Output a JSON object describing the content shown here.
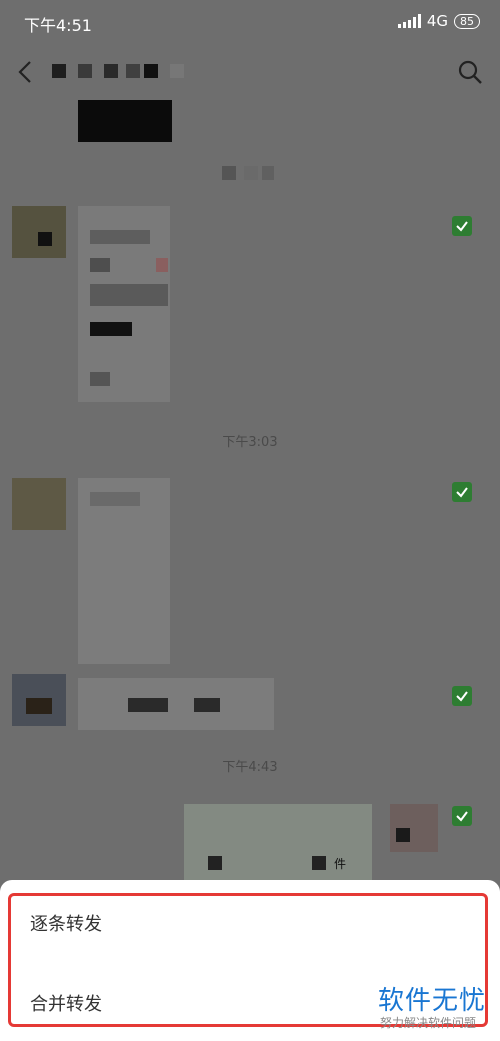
{
  "status_bar": {
    "time": "下午4:51",
    "network": "4G",
    "battery": "85"
  },
  "chat": {
    "timestamps": [
      "下午3:03",
      "下午4:43"
    ],
    "file_label": "件"
  },
  "sheet": {
    "options": [
      "逐条转发",
      "合并转发"
    ]
  },
  "watermark": {
    "title": "软件无忧",
    "subtitle": "努力解决软件问题"
  },
  "colors": {
    "accent_check": "#2e7d32",
    "highlight": "#e53935",
    "watermark": "#1976d2"
  }
}
